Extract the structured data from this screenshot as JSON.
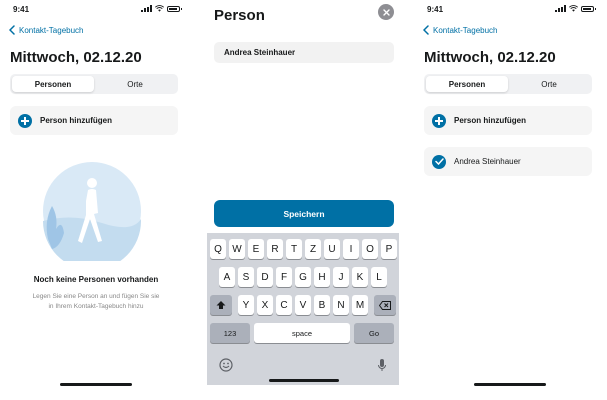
{
  "status": {
    "time": "9:41"
  },
  "nav": {
    "back_label": "Kontakt-Tagebuch"
  },
  "day": {
    "title": "Mittwoch, 02.12.20"
  },
  "tabs": [
    {
      "label": "Personen"
    },
    {
      "label": "Orte"
    }
  ],
  "add_person": {
    "label": "Person hinzufügen"
  },
  "empty": {
    "title": "Noch keine Personen vorhanden",
    "description": "Legen Sie eine Person an und fügen Sie sie in Ihrem Kontakt-Tagebuch hinzu"
  },
  "modal": {
    "title": "Person",
    "name_value": "Andrea Steinhauer",
    "save_label": "Speichern"
  },
  "keyboard": {
    "row1": [
      "Q",
      "W",
      "E",
      "R",
      "T",
      "Z",
      "U",
      "I",
      "O",
      "P"
    ],
    "row2": [
      "A",
      "S",
      "D",
      "F",
      "G",
      "H",
      "J",
      "K",
      "L"
    ],
    "row3": [
      "Y",
      "X",
      "C",
      "V",
      "B",
      "N",
      "M"
    ],
    "numbers_label": "123",
    "space_label": "space",
    "go_label": "Go"
  },
  "person_list": [
    {
      "name": "Andrea Steinhauer"
    }
  ],
  "colors": {
    "accent": "#0070a5",
    "card": "#f5f5f5",
    "keyboard_bg": "#d1d4da"
  }
}
